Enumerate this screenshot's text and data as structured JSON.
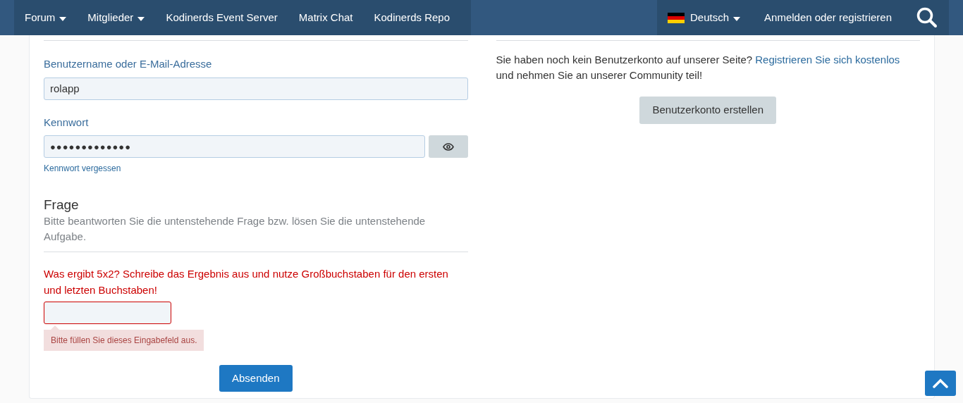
{
  "nav": {
    "left": [
      {
        "label": "Forum",
        "dropdown": true
      },
      {
        "label": "Mitglieder",
        "dropdown": true
      },
      {
        "label": "Kodinerds Event Server",
        "dropdown": false
      },
      {
        "label": "Matrix Chat",
        "dropdown": false
      },
      {
        "label": "Kodinerds Repo",
        "dropdown": false
      }
    ],
    "language": {
      "label": "Deutsch",
      "dropdown": true
    },
    "login": "Anmelden oder registrieren"
  },
  "login_form": {
    "username": {
      "label": "Benutzername oder E-Mail-Adresse",
      "value": "rolapp"
    },
    "password": {
      "label": "Kennwort",
      "value": "●●●●●●●●●●●●●",
      "forgot": "Kennwort vergessen"
    }
  },
  "question": {
    "title": "Frage",
    "description": "Bitte beantworten Sie die untenstehende Frage bzw. lösen Sie die untenstehende Aufgabe.",
    "prompt": "Was ergibt 5x2? Schreibe das Ergebnis aus und nutze Großbuchstaben für den ersten und letzten Buchstaben!",
    "answer": {
      "invalid": true,
      "error": "Bitte füllen Sie dieses Eingabefeld aus."
    },
    "submit": "Absenden"
  },
  "register": {
    "text": "Sie haben noch kein Benutzerkonto auf unserer Seite?",
    "link": "Registrieren Sie sich kostenlos",
    "text_after": "und nehmen Sie an unserer Community teil!",
    "button": "Benutzerkonto erstellen"
  }
}
